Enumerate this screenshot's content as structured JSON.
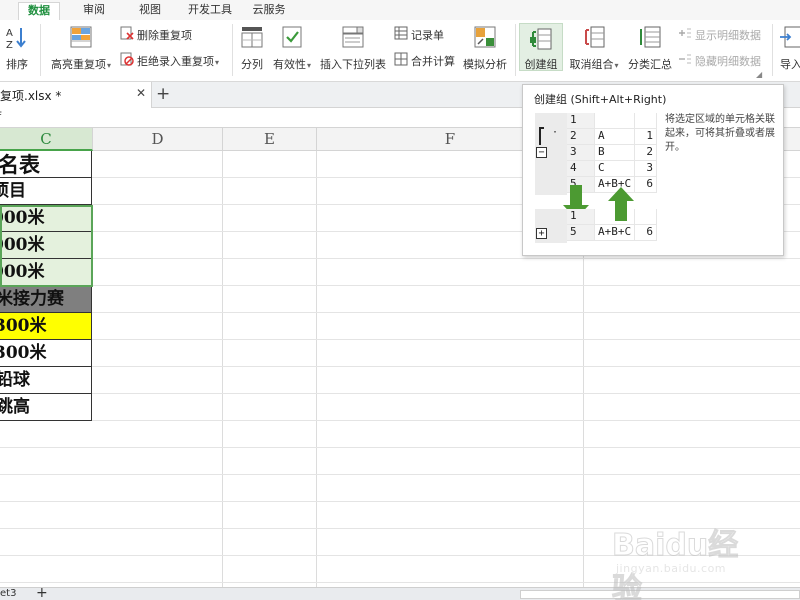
{
  "tabs": [
    "数据",
    "审阅",
    "视图",
    "开发工具",
    "云服务"
  ],
  "active_tab": "数据",
  "accent_color": "#1e8f3e",
  "ribbon": {
    "sort": "排序",
    "highlight_dup": "高亮重复项",
    "delete_dup": "删除重复项",
    "reject_dup": "拒绝录入重复项",
    "split_col": "分列",
    "validity": "有效性",
    "insert_dropdown": "插入下拉列表",
    "record_form": "记录单",
    "merge_calc": "合并计算",
    "simulate": "模拟分析",
    "create_group": "创建组",
    "ungroup": "取消组合",
    "subtotal": "分类汇总",
    "show_detail": "显示明细数据",
    "hide_detail": "隐藏明细数据",
    "import": "导入"
  },
  "file": {
    "name": "复项.xlsx *",
    "close": "✕",
    "add": "+"
  },
  "formula": {
    "fx": "f"
  },
  "columns": [
    "C",
    "D",
    "E",
    "F"
  ],
  "cells": [
    {
      "text": "名表",
      "bg": "#ffffff"
    },
    {
      "text": "项目",
      "bg": "#ffffff"
    },
    {
      "text": "000米",
      "bg": "#e4f1dd"
    },
    {
      "text": "000米",
      "bg": "#e4f1dd"
    },
    {
      "text": "000米",
      "bg": "#e4f1dd"
    },
    {
      "text": "米接力赛",
      "bg": "#7f7f7f"
    },
    {
      "text": "300米",
      "bg": "#ffff00"
    },
    {
      "text": "300米",
      "bg": "#ffffff"
    },
    {
      "text": "铅球",
      "bg": "#ffffff"
    },
    {
      "text": "跳高",
      "bg": "#ffffff"
    }
  ],
  "tooltip": {
    "title": "创建组 (Shift+Alt+Right)",
    "description": "将选定区域的单元格关联起来，可将其折叠或者展开。",
    "minus": "−",
    "plus": "+",
    "dot": "·",
    "top_rows": [
      {
        "num": "1",
        "a": "",
        "b": ""
      },
      {
        "num": "2",
        "a": "A",
        "b": "1"
      },
      {
        "num": "3",
        "a": "B",
        "b": "2"
      },
      {
        "num": "4",
        "a": "C",
        "b": "3"
      },
      {
        "num": "5",
        "a": "A+B+C",
        "b": "6"
      }
    ],
    "bottom_rows": [
      {
        "num": "1",
        "a": "",
        "b": ""
      },
      {
        "num": "5",
        "a": "A+B+C",
        "b": "6"
      }
    ]
  },
  "sheet": {
    "name": "et3",
    "add": "+"
  },
  "watermark": {
    "brand": "Baidu经验",
    "url": "jingyan.baidu.com"
  }
}
